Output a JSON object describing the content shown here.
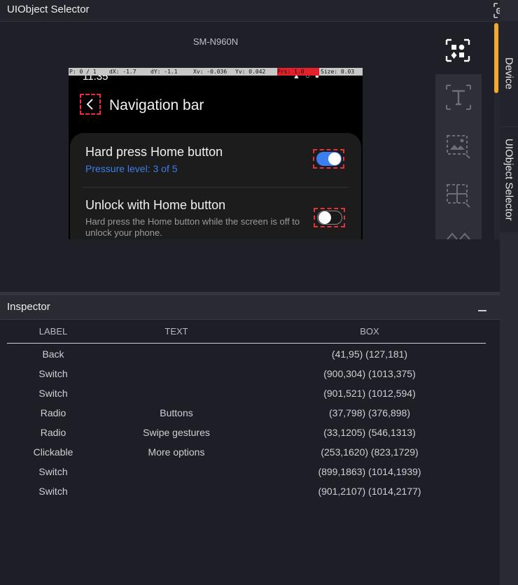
{
  "window": {
    "title": "UIObject Selector"
  },
  "side_tabs": [
    {
      "label": "Device"
    },
    {
      "label": "UIObject Selector"
    }
  ],
  "device": {
    "name": "SM-N960N",
    "debug_overlay": {
      "p": "P: 0 / 1",
      "dx": "dX: -1.7",
      "dy": "dY: -1.1",
      "xv": "Xv: -0.036",
      "yv": "Yv: 0.042",
      "prs": "Prs: 1.0",
      "size": "Size: 0.03"
    },
    "status_time": "11:35",
    "screen_title": "Navigation bar",
    "rows": [
      {
        "title": "Hard press Home button",
        "subtitle": "Pressure level: 3 of 5",
        "switch_on": true
      },
      {
        "title": "Unlock with Home button",
        "description": "Hard press the Home button while the screen is off to unlock your phone.",
        "switch_on": false
      }
    ]
  },
  "tools": [
    {
      "icon": "select-objects-icon"
    },
    {
      "icon": "text-tool-icon"
    },
    {
      "icon": "image-tool-icon"
    },
    {
      "icon": "grid-tool-icon"
    },
    {
      "icon": "expand-tool-icon"
    }
  ],
  "inspector": {
    "title": "Inspector",
    "columns": {
      "label": "LABEL",
      "text": "TEXT",
      "box": "BOX"
    },
    "rows": [
      {
        "label": "Back",
        "text": "",
        "box": "(41,95) (127,181)"
      },
      {
        "label": "Switch",
        "text": "",
        "box": "(900,304) (1013,375)"
      },
      {
        "label": "Switch",
        "text": "",
        "box": "(901,521) (1012,594)"
      },
      {
        "label": "Radio",
        "text": "Buttons",
        "box": "(37,798) (376,898)"
      },
      {
        "label": "Radio",
        "text": "Swipe gestures",
        "box": "(33,1205) (546,1313)"
      },
      {
        "label": "Clickable",
        "text": "More options",
        "box": "(253,1620) (823,1729)"
      },
      {
        "label": "Switch",
        "text": "",
        "box": "(899,1863) (1014,1939)"
      },
      {
        "label": "Switch",
        "text": "",
        "box": "(901,2107) (1014,2177)"
      }
    ]
  },
  "colors": {
    "accent": "#f0a830",
    "selection_outline": "#e8303a",
    "switch_on": "#3a7ef0",
    "link_blue": "#3e7ee8"
  }
}
